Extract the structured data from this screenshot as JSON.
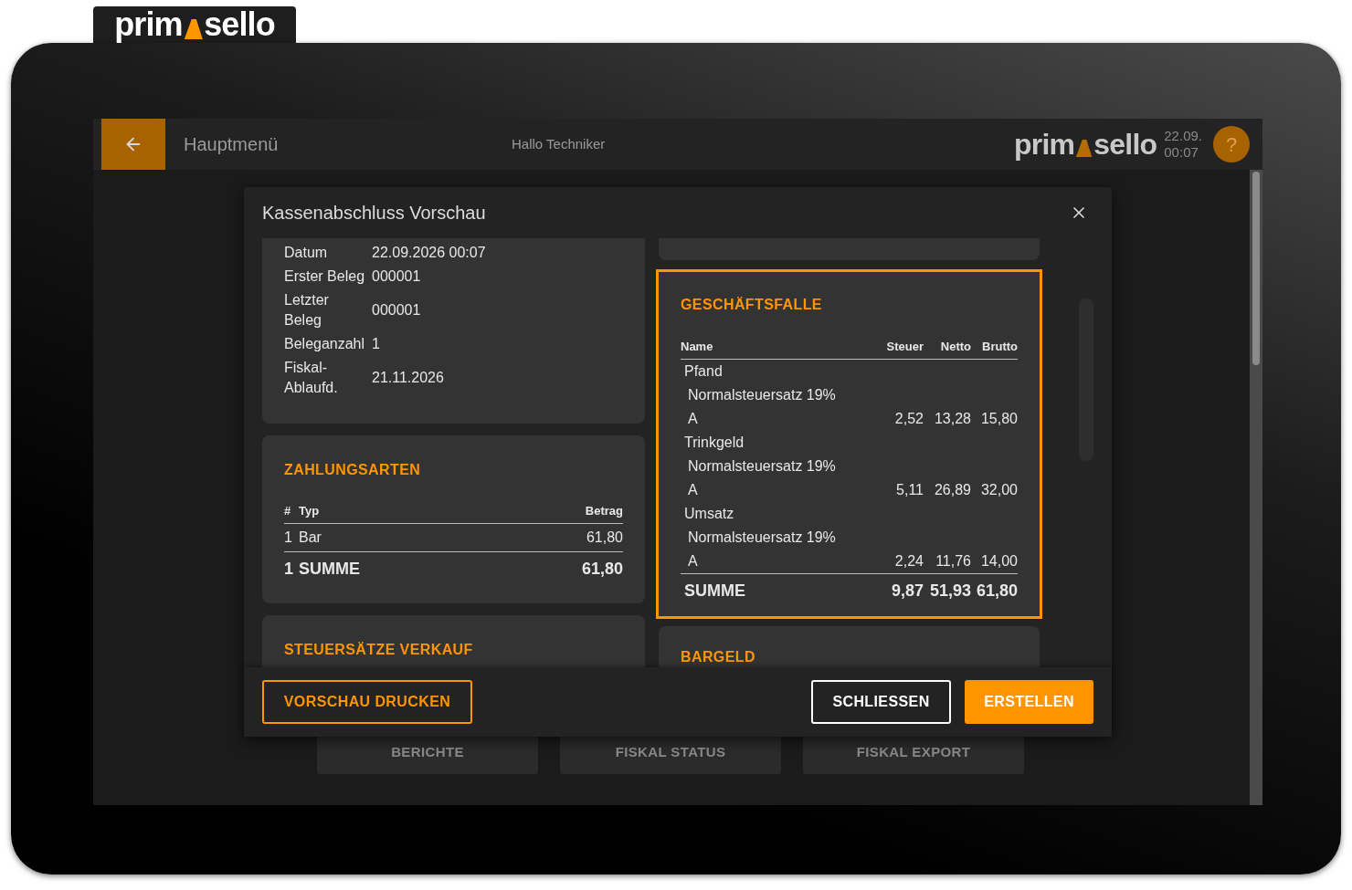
{
  "brand_tab": {
    "logo": {
      "left": "prim",
      "right": "sello"
    }
  },
  "header": {
    "back_label": "Hauptmenü",
    "greeting": "Hallo Techniker",
    "logo": {
      "left": "prim",
      "right": "sello"
    },
    "date": "22.09.",
    "time": "00:07",
    "help": "?"
  },
  "background_buttons": [
    "BERICHTE",
    "FISKAL STATUS",
    "FISKAL EXPORT"
  ],
  "dialog": {
    "title": "Kassenabschluss Vorschau",
    "summary": [
      {
        "label": "Datum",
        "value": "22.09.2026 00:07"
      },
      {
        "label": "Erster Beleg",
        "value": "000001"
      },
      {
        "label": "Letzter Beleg",
        "value": "000001"
      },
      {
        "label": "Beleganzahl",
        "value": "1"
      },
      {
        "label": "Fiskal-Ablaufd.",
        "value": "21.11.2026"
      }
    ],
    "payments": {
      "title": "ZAHLUNGSARTEN",
      "columns": [
        "#",
        "Typ",
        "Betrag"
      ],
      "rows": [
        {
          "number": "1",
          "type": "Bar",
          "amount": "61,80"
        }
      ],
      "total": {
        "number": "1",
        "label": "SUMME",
        "amount": "61,80"
      }
    },
    "tax_rates": {
      "title": "STEUERSÄTZE VERKAUF"
    },
    "business_cases": {
      "title": "GESCHÄFTSFALLE",
      "highlighted": true,
      "columns": [
        "Name",
        "Steuer",
        "Netto",
        "Brutto"
      ],
      "groups": [
        {
          "name": "Pfand",
          "rate": "Normalsteuersatz 19%",
          "code": "A",
          "tax": "2,52",
          "net": "13,28",
          "gross": "15,80"
        },
        {
          "name": "Trinkgeld",
          "rate": "Normalsteuersatz 19%",
          "code": "A",
          "tax": "5,11",
          "net": "26,89",
          "gross": "32,00"
        },
        {
          "name": "Umsatz",
          "rate": "Normalsteuersatz 19%",
          "code": "A",
          "tax": "2,24",
          "net": "11,76",
          "gross": "14,00"
        }
      ],
      "total": {
        "label": "SUMME",
        "tax": "9,87",
        "net": "51,93",
        "gross": "61,80"
      }
    },
    "cash": {
      "title": "BARGELD"
    },
    "buttons": [
      {
        "label": "VORSCHAU DRUCKEN",
        "kind": "outline"
      },
      {
        "label": "SCHLIESSEN",
        "kind": "secondary"
      },
      {
        "label": "ERSTELLEN",
        "kind": "primary"
      }
    ]
  }
}
